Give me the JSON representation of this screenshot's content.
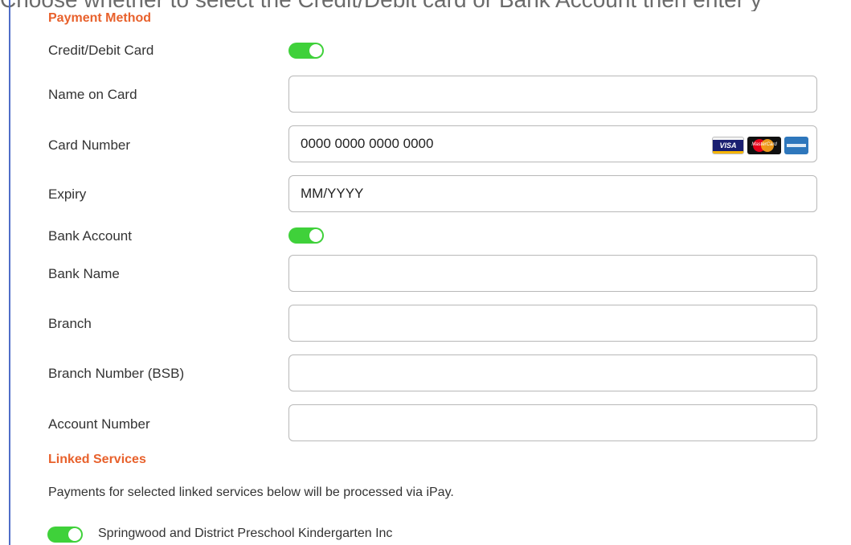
{
  "page": {
    "top_cut_text": "Choose whether to select the Credit/Debit card or Bank Account then enter y"
  },
  "payment_method": {
    "title": "Payment Method",
    "credit_debit_card_label": "Credit/Debit Card",
    "credit_debit_card_enabled": true,
    "name_on_card_label": "Name on Card",
    "name_on_card_value": "",
    "card_number_label": "Card Number",
    "card_number_placeholder": "0000 0000 0000 0000",
    "card_brands": [
      "visa-card-icon",
      "mastercard-icon",
      "amex-card-icon"
    ],
    "card_brand_texts": {
      "visa": "VISA",
      "mastercard": "MasterCard"
    },
    "expiry_label": "Expiry",
    "expiry_placeholder": "MM/YYYY",
    "bank_account_label": "Bank Account",
    "bank_account_enabled": true,
    "bank_name_label": "Bank Name",
    "branch_label": "Branch",
    "branch_number_label": "Branch Number (BSB)",
    "account_number_label": "Account Number"
  },
  "linked_services": {
    "title": "Linked Services",
    "description": "Payments for selected linked services below will be processed via iPay.",
    "services": [
      {
        "name": "Springwood and District Preschool Kindergarten Inc",
        "enabled": true
      }
    ]
  },
  "colors": {
    "accent_orange": "#e8612c",
    "toggle_green": "#3fd13a",
    "left_rule": "#4f6ec8"
  }
}
